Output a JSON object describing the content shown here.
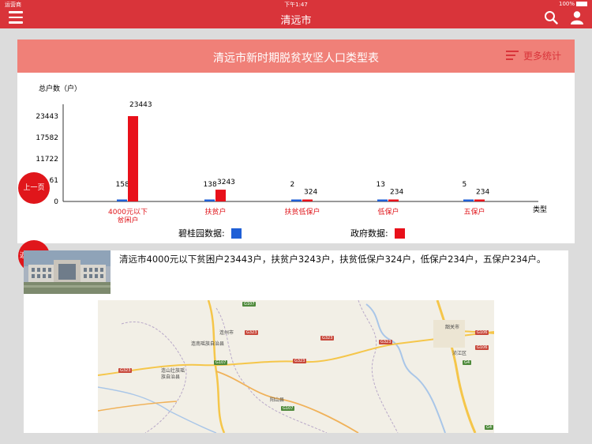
{
  "status_bar": {
    "carrier": "运营商",
    "time": "下午1:47",
    "battery": "100%"
  },
  "nav": {
    "title": "清远市"
  },
  "panel": {
    "title": "清远市新时期脱贫攻坚人口类型表",
    "more_label": "更多统计"
  },
  "chart_data": {
    "type": "bar",
    "ylabel": "总户数（户）",
    "xlabel": "类型",
    "y_ticks": [
      "0",
      "61",
      "11722",
      "17582",
      "23443"
    ],
    "ylim": [
      0,
      23443
    ],
    "categories": [
      [
        "4000元以下",
        "贫困户"
      ],
      [
        "扶贫户"
      ],
      [
        "扶贫低保户"
      ],
      [
        "低保户"
      ],
      [
        "五保户"
      ]
    ],
    "series": [
      {
        "name": "碧桂园数据",
        "color": "#1f5fd6",
        "values": [
          158,
          138,
          2,
          13,
          5
        ],
        "labels": [
          "158",
          "138",
          "2",
          "13",
          "5"
        ]
      },
      {
        "name": "政府数据",
        "color": "#e8101a",
        "values": [
          23443,
          3243,
          324,
          234,
          234
        ],
        "labels": [
          "23443",
          "3243",
          "324",
          "234",
          "234"
        ]
      }
    ],
    "legend": [
      {
        "label": "碧桂园数据:",
        "color": "#1f5fd6"
      },
      {
        "label": "政府数据:",
        "color": "#e8101a"
      }
    ],
    "grid": false
  },
  "buttons": {
    "prev": "上一页",
    "home": "返回首页"
  },
  "content": {
    "summary": "清远市4000元以下贫困户23443户，扶贫户3243户，扶贫低保户324户，低保户234户，五保户234户。"
  },
  "map": {
    "places": [
      "连州市",
      "连南瑶族自治县",
      "连山壮族瑶族自治县",
      "阳山县",
      "韶关市",
      "浈江区"
    ],
    "roads": [
      "G107",
      "G323",
      "G323",
      "G323",
      "G323",
      "G107",
      "G323",
      "G106",
      "G106",
      "G4",
      "G107",
      "G4"
    ]
  }
}
